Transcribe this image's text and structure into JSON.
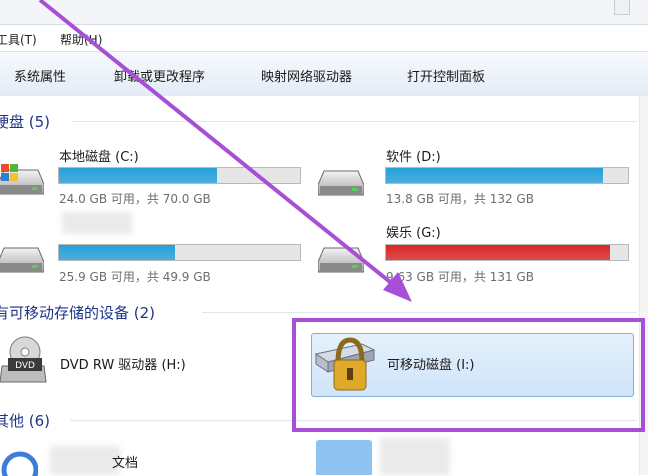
{
  "menubar": {
    "tools": "工具(T)",
    "help": "帮助(H)"
  },
  "toolbar": {
    "system_props": "系统属性",
    "uninstall": "卸载或更改程序",
    "map_drive": "映射网络驱动器",
    "control_panel": "打开控制面板"
  },
  "groups": {
    "hard_disks": "硬盘 (5)",
    "removable": "有可移动存储的设备 (2)",
    "other": "其他 (6)"
  },
  "drives": [
    {
      "name": "本地磁盘 (C:)",
      "sub": "24.0 GB 可用，共 70.0 GB",
      "used_fraction": 0.657,
      "color": "#26a0da"
    },
    {
      "name": "软件 (D:)",
      "sub": "13.8 GB 可用，共 132 GB",
      "used_fraction": 0.895,
      "color": "#26a0da"
    },
    {
      "name": "",
      "sub": "25.9 GB 可用，共 49.9 GB",
      "used_fraction": 0.481,
      "color": "#26a0da"
    },
    {
      "name": "娱乐 (G:)",
      "sub": "9.63 GB 可用，共 131 GB",
      "used_fraction": 0.926,
      "color": "#da2626"
    }
  ],
  "removable": [
    {
      "name": "DVD RW 驱动器 (H:)",
      "icon_text": "DVD"
    },
    {
      "name": "可移动磁盘 (I:)"
    }
  ],
  "other": [
    {
      "name": "文档"
    }
  ]
}
